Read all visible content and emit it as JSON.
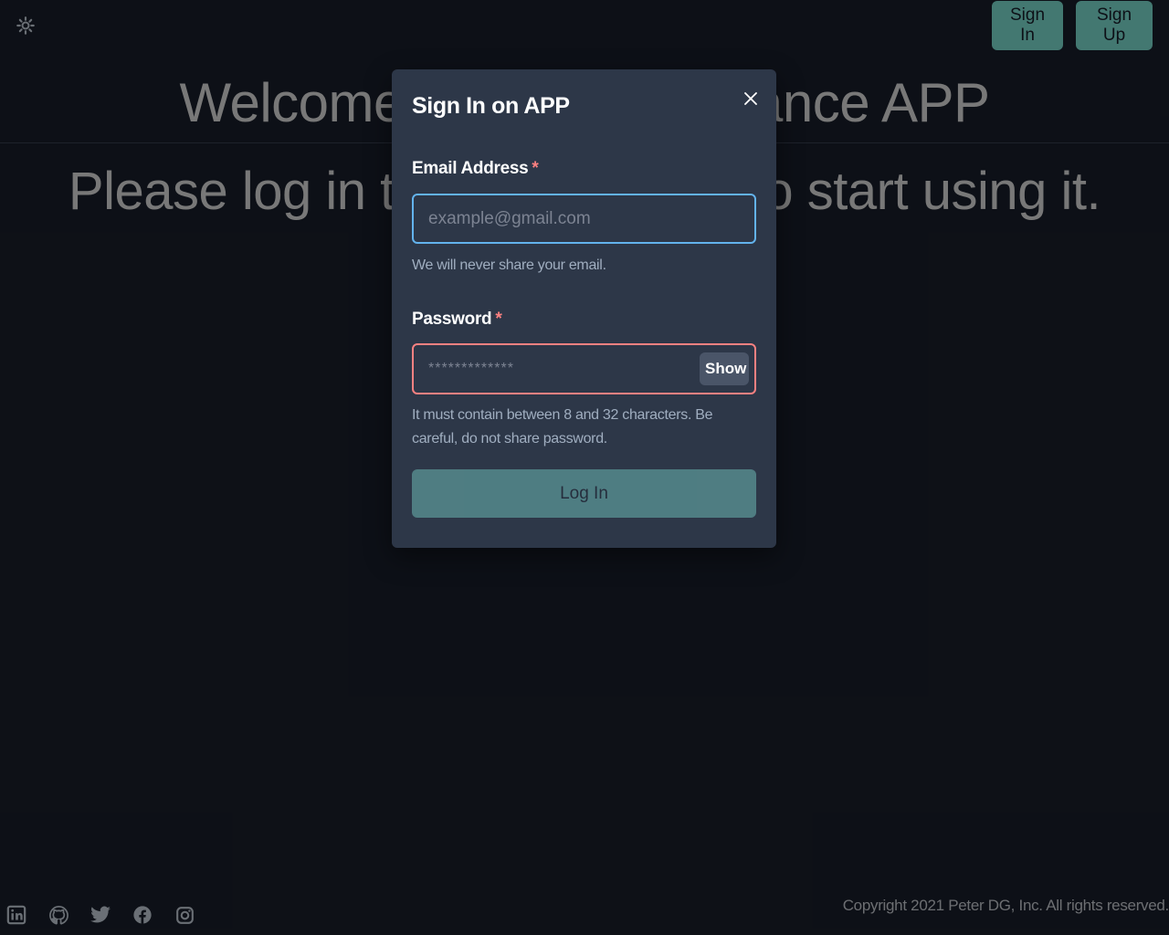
{
  "header": {
    "theme_icon": "sun-gear-icon",
    "sign_in_label": "Sign In",
    "sign_up_label": "Sign Up"
  },
  "hero": {
    "title": "Welcome to the Fire-Finance APP",
    "subtitle": "Please log in to your account to start using it."
  },
  "modal": {
    "title": "Sign In on APP",
    "close_icon": "close-icon",
    "email": {
      "label": "Email Address",
      "required_mark": "*",
      "placeholder": "example@gmail.com",
      "value": "",
      "help": "We will never share your email."
    },
    "password": {
      "label": "Password",
      "required_mark": "*",
      "placeholder": "*************",
      "value": "",
      "toggle_label": "Show",
      "help": "It must contain between 8 and 32 characters. Be careful, do not share password."
    },
    "submit_label": "Log In",
    "submit_disabled": true
  },
  "footer": {
    "social_icons": [
      "linkedin-icon",
      "github-icon",
      "twitter-icon",
      "facebook-icon",
      "instagram-icon"
    ],
    "copyright": "Copyright 2021 Peter DG, Inc. All rights reserved."
  },
  "colors": {
    "accent": "#81e6d9",
    "background": "#1a202c",
    "modal_bg": "#2d3748",
    "focus_border": "#63b3ed",
    "error_border": "#fc8181"
  }
}
